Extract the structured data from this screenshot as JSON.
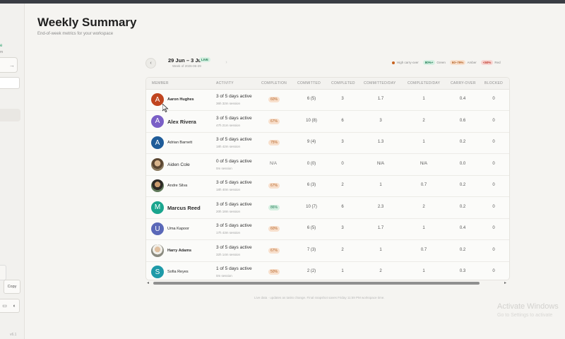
{
  "page": {
    "title": "Weekly Summary",
    "subtitle": "End-of-week metrics for your workspace"
  },
  "week": {
    "range": "29 Jun – 3 Jul",
    "live_badge": "LIVE",
    "week_of": "Week of 2026-06-29",
    "prev_icon": "chevron-left-icon",
    "next_icon": "chevron-right-icon"
  },
  "legend": {
    "high_carry_over": "High carry-over",
    "green_chip": "80%+",
    "green_label": "Green",
    "amber_chip": "60–79%",
    "amber_label": "Amber",
    "red_chip": "<60%",
    "red_label": "Red",
    "colors": {
      "high": "#c7621f",
      "green": "#1d7c53",
      "amber": "#b56326",
      "red": "#c0392b"
    }
  },
  "table": {
    "columns": [
      "MEMBER",
      "ACTIVITY",
      "COMPLETION",
      "COMMITTED",
      "COMPLETED",
      "COMMITTED/DAY",
      "COMPLETED/DAY",
      "CARRY-OVER",
      "BLOCKED"
    ],
    "rows": [
      {
        "name": "Aaron Hughes",
        "initial": "A",
        "avatar_color": "#c0451f",
        "activity": "3 of 5 days active",
        "session": "36h 32m session",
        "completion": "60%",
        "completion_level": "amber",
        "committed": "6 (5)",
        "completed": "3",
        "committed_day": "1.7",
        "completed_day": "1",
        "carry_over": "0.4",
        "blocked": "0"
      },
      {
        "name": "Alex Rivera",
        "initial": "A",
        "avatar_color": "#7a5fc6",
        "activity": "3 of 5 days active",
        "session": "47h 21m session",
        "completion": "67%",
        "completion_level": "amber",
        "committed": "10 (8)",
        "completed": "6",
        "committed_day": "3",
        "completed_day": "2",
        "carry_over": "0.6",
        "blocked": "0"
      },
      {
        "name": "Adrian Barnett",
        "initial": "A",
        "avatar_color": "#1f5c99",
        "activity": "3 of 5 days active",
        "session": "18h 42m session",
        "completion": "75%",
        "completion_level": "amber",
        "committed": "9 (4)",
        "completed": "3",
        "committed_day": "1.3",
        "completed_day": "1",
        "carry_over": "0.2",
        "blocked": "0"
      },
      {
        "name": "Aiden Cole",
        "initial": "",
        "avatar_color": "photo",
        "activity": "0 of 5 days active",
        "session": "0m session",
        "completion": "N/A",
        "completion_level": "na",
        "committed": "0 (0)",
        "completed": "0",
        "committed_day": "N/A",
        "completed_day": "N/A",
        "carry_over": "0.0",
        "blocked": "0"
      },
      {
        "name": "Andre Silva",
        "initial": "",
        "avatar_color": "photo2",
        "activity": "3 of 5 days active",
        "session": "18h 40m session",
        "completion": "67%",
        "completion_level": "amber",
        "committed": "6 (3)",
        "completed": "2",
        "committed_day": "1",
        "completed_day": "0.7",
        "carry_over": "0.2",
        "blocked": "0"
      },
      {
        "name": "Marcus Reed",
        "initial": "M",
        "avatar_color": "#1aa58e",
        "activity": "3 of 5 days active",
        "session": "20h 18m session",
        "completion": "86%",
        "completion_level": "green",
        "committed": "10 (7)",
        "completed": "6",
        "committed_day": "2.3",
        "completed_day": "2",
        "carry_over": "0.2",
        "blocked": "0"
      },
      {
        "name": "Uma Kapoor",
        "initial": "U",
        "avatar_color": "#5a68b8",
        "activity": "3 of 5 days active",
        "session": "17h 43m session",
        "completion": "60%",
        "completion_level": "amber",
        "committed": "6 (5)",
        "completed": "3",
        "committed_day": "1.7",
        "completed_day": "1",
        "carry_over": "0.4",
        "blocked": "0"
      },
      {
        "name": "Harry Adams",
        "initial": "",
        "avatar_color": "photo3",
        "activity": "3 of 5 days active",
        "session": "32h 14m session",
        "completion": "67%",
        "completion_level": "amber",
        "committed": "7 (3)",
        "completed": "2",
        "committed_day": "1",
        "completed_day": "0.7",
        "carry_over": "0.2",
        "blocked": "0"
      },
      {
        "name": "Sofia Reyes",
        "initial": "S",
        "avatar_color": "#1e9aa8",
        "activity": "1 of 5 days active",
        "session": "0m session",
        "completion": "50%",
        "completion_level": "amber",
        "committed": "2 (2)",
        "completed": "1",
        "committed_day": "2",
        "completed_day": "1",
        "carry_over": "0.3",
        "blocked": "0"
      }
    ]
  },
  "footer": {
    "note": "Live data · updates as tasks change. Final snapshot saves Friday 11:59 PM workspace time."
  },
  "sidebar": {
    "copy_label": "Copy",
    "version": "v6.1"
  },
  "watermark": {
    "line1": "Activate Windows",
    "line2": "Go to Settings to activate"
  }
}
